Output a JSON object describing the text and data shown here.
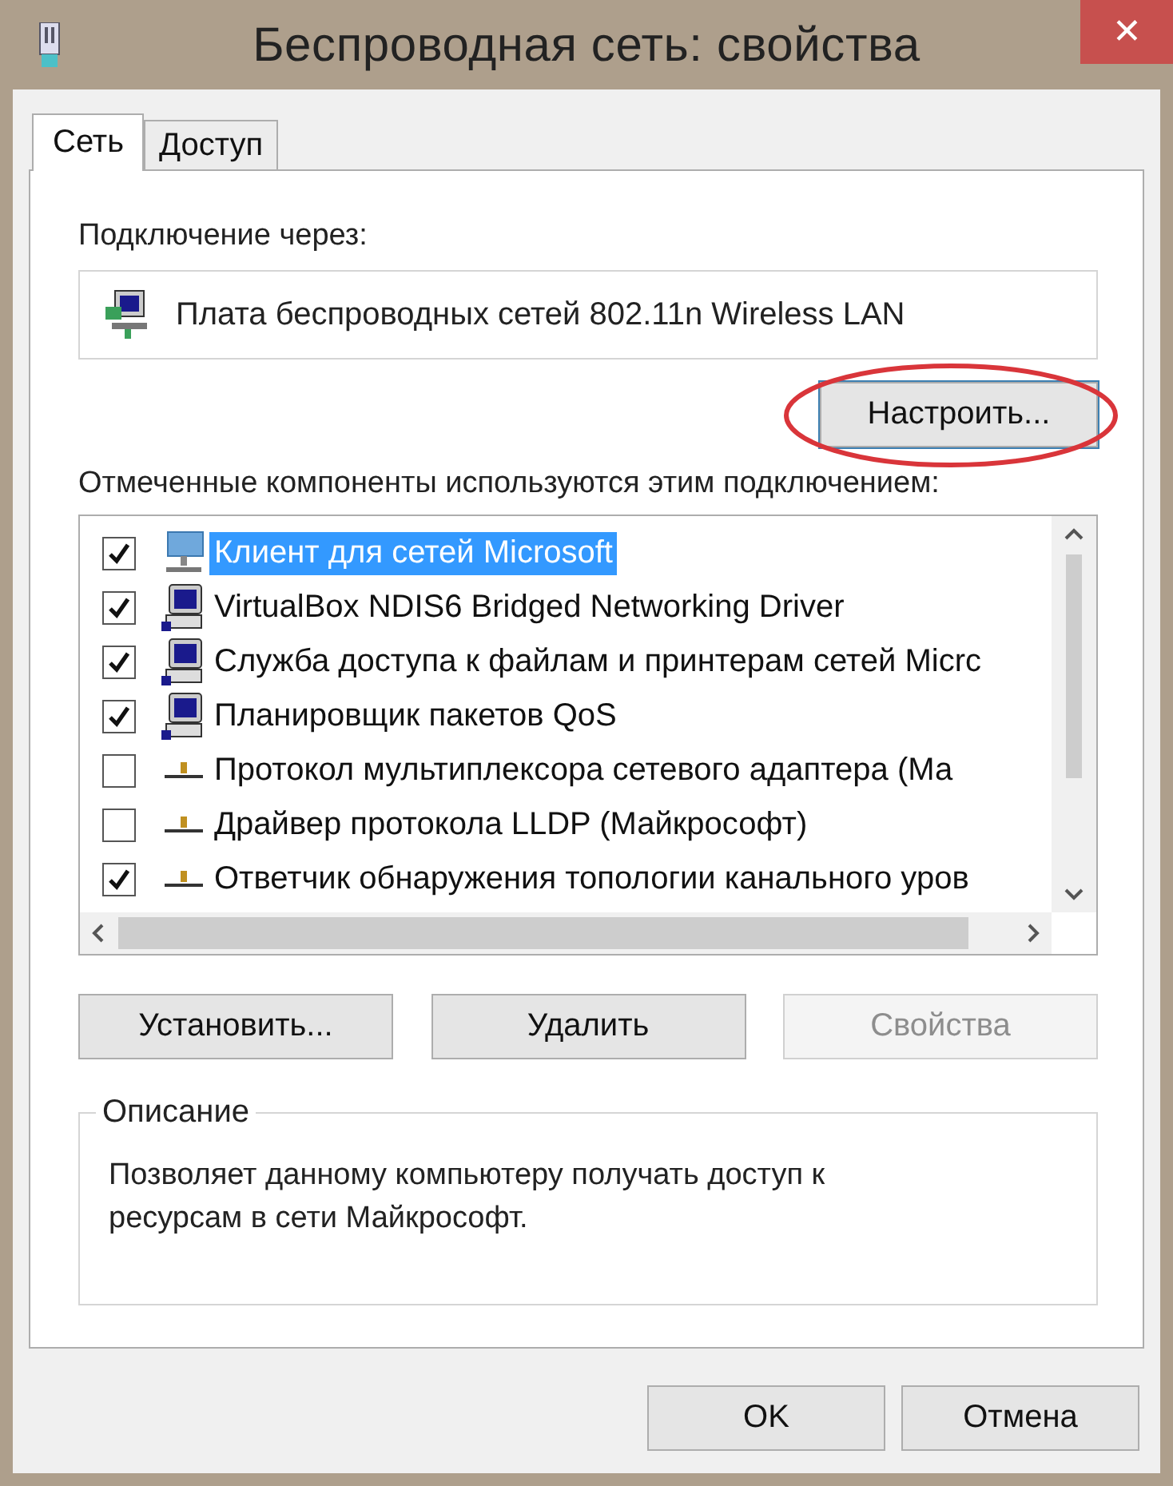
{
  "window": {
    "title": "Беспроводная сеть: свойства",
    "close": "✕"
  },
  "tabs": [
    {
      "label": "Сеть",
      "selected": true
    },
    {
      "label": "Доступ",
      "selected": false
    }
  ],
  "connect_label": "Подключение через:",
  "adapter": "Плата беспроводных сетей 802.11n Wireless LAN",
  "configure_button": {
    "label": "Настроить...",
    "highlighted": true
  },
  "components_label": "Отмеченные компоненты используются этим подключением:",
  "components": [
    {
      "label": "Клиент для сетей Microsoft",
      "checked": true,
      "selected": true,
      "kind": "client"
    },
    {
      "label": "VirtualBox NDIS6 Bridged Networking Driver",
      "checked": true,
      "selected": false,
      "kind": "service"
    },
    {
      "label": "Служба доступа к файлам и принтерам сетей Micrc",
      "checked": true,
      "selected": false,
      "kind": "service"
    },
    {
      "label": "Планировщик пакетов QoS",
      "checked": true,
      "selected": false,
      "kind": "service"
    },
    {
      "label": "Протокол мультиплексора сетевого адаптера (Ма",
      "checked": false,
      "selected": false,
      "kind": "protocol"
    },
    {
      "label": "Драйвер протокола LLDP (Майкрософт)",
      "checked": false,
      "selected": false,
      "kind": "protocol"
    },
    {
      "label": "Ответчик обнаружения топологии канального уров",
      "checked": true,
      "selected": false,
      "kind": "protocol"
    }
  ],
  "component_buttons": [
    {
      "label": "Установить...",
      "disabled": false
    },
    {
      "label": "Удалить",
      "disabled": false
    },
    {
      "label": "Свойства",
      "disabled": true
    }
  ],
  "description": {
    "title": "Описание",
    "text": "Позволяет данному компьютеру получать доступ к ресурсам в сети Майкрософт."
  },
  "dialog_buttons": [
    {
      "label": "OK"
    },
    {
      "label": "Отмена"
    }
  ]
}
